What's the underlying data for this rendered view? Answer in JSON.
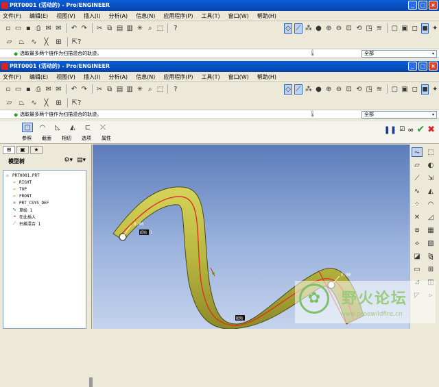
{
  "window1": {
    "title": "PRT0001 (活动的) - Pro/ENGINEER"
  },
  "window2": {
    "title": "PRT0001 (活动的) - Pro/ENGINEER"
  },
  "menu": [
    "文件(F)",
    "编辑(E)",
    "视图(V)",
    "插入(I)",
    "分析(A)",
    "信息(N)",
    "应用程序(P)",
    "工具(T)",
    "窗口(W)",
    "帮助(H)"
  ],
  "message": "选取最多两个链作为扫描混合的轨迹。",
  "filter": {
    "value": "全部"
  },
  "dashboard": {
    "tabs": [
      "参照",
      "截面",
      "相切",
      "选项",
      "属性"
    ]
  },
  "model_tree": {
    "title": "模型树",
    "items": [
      {
        "label": "PRT0001.PRT",
        "icon": "part-icon",
        "level": 0
      },
      {
        "label": "RIGHT",
        "icon": "datum-plane-icon",
        "level": 1
      },
      {
        "label": "TOP",
        "icon": "datum-plane-icon",
        "level": 1
      },
      {
        "label": "FRONT",
        "icon": "datum-plane-icon",
        "level": 1
      },
      {
        "label": "PRT_CSYS_DEF",
        "icon": "csys-icon",
        "level": 1
      },
      {
        "label": "草绘 1",
        "icon": "sketch-icon",
        "level": 1
      },
      {
        "label": "在此插入",
        "icon": "insert-here-icon",
        "level": 1
      },
      {
        "label": "扫描混合 1",
        "icon": "swept-blend-icon",
        "level": 1
      }
    ]
  },
  "viewport_labels": {
    "dim_left": "0.00",
    "dim_right": "0.00",
    "start_label": "起始",
    "tag_1": "1"
  },
  "watermark": {
    "title": "野火论坛",
    "url": "www.proewildfire.cn"
  },
  "colors": {
    "title_bar": "#0a5fdb",
    "sweep_body": "#b9b740",
    "trajectory": "#e03020",
    "viewport_top": "#5c7bb9",
    "viewport_bottom": "#c4d3ec"
  }
}
